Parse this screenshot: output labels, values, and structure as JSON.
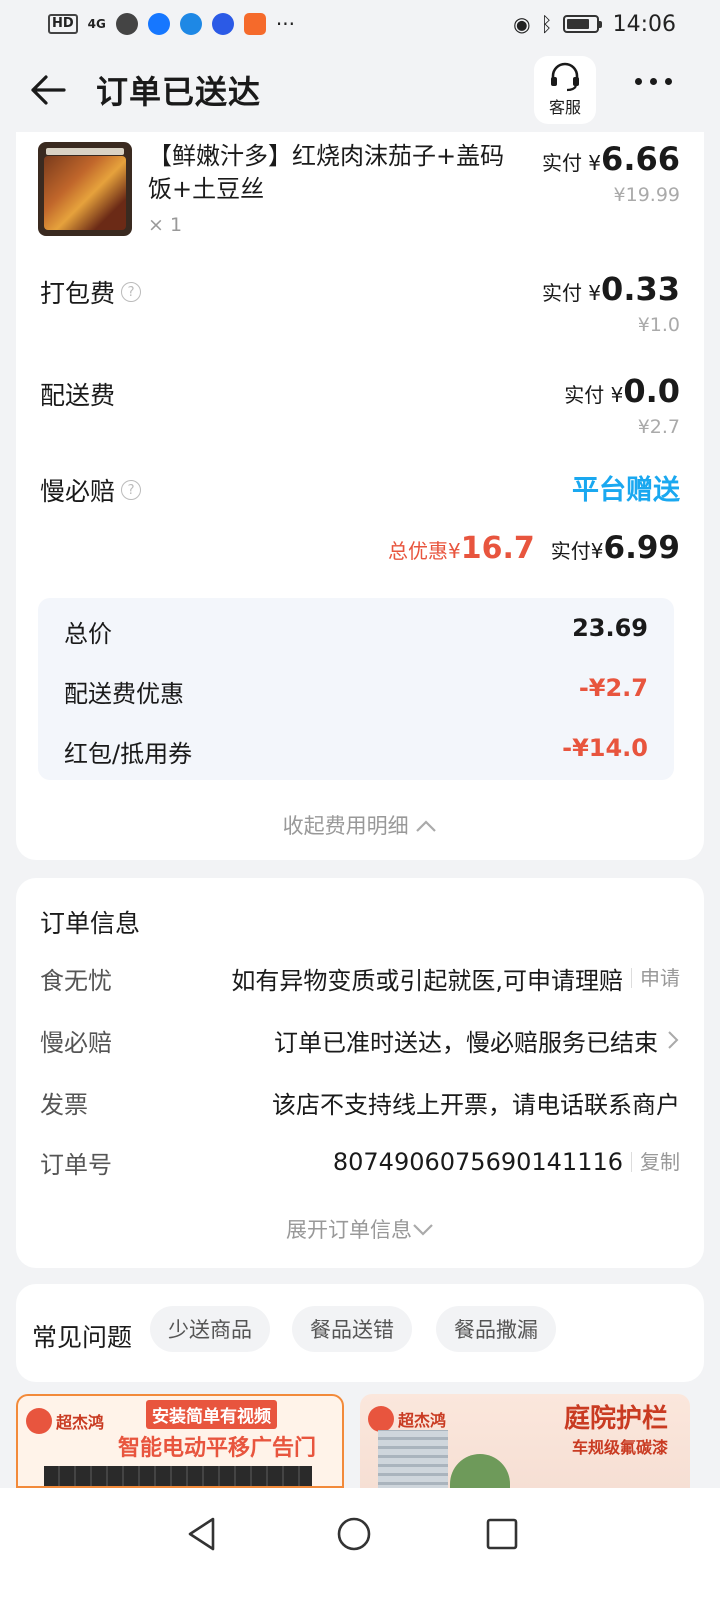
{
  "status_bar": {
    "network": "HD",
    "signal": "4G",
    "time": "14:06"
  },
  "header": {
    "title": "订单已送达",
    "service_label": "客服"
  },
  "item": {
    "name": "【鲜嫩汁多】红烧肉沫茄子+盖码饭+土豆丝",
    "qty": "× 1",
    "paid_prefix": "实付 ¥",
    "paid": "6.66",
    "original": "¥19.99"
  },
  "fees": [
    {
      "label": "打包费",
      "paid_prefix": "实付 ¥",
      "paid": "0.33",
      "original": "¥1.0"
    },
    {
      "label": "配送费",
      "paid_prefix": "实付 ¥",
      "paid": "0.0",
      "original": "¥2.7"
    }
  ],
  "slow_compensation": {
    "label": "慢必赔",
    "value": "平台赠送"
  },
  "summary": {
    "discount_label": "总优惠¥",
    "discount": "16.7",
    "paid_label": "实付¥",
    "paid": "6.99"
  },
  "breakdown": [
    {
      "label": "总价",
      "value": "23.69"
    },
    {
      "label": "配送费优惠",
      "value": "-¥2.7"
    },
    {
      "label": "红包/抵用券",
      "value": "-¥14.0"
    }
  ],
  "collapse_label": "收起费用明细",
  "order_info": {
    "title": "订单信息",
    "rows": [
      {
        "key": "食无忧",
        "value": "如有异物变质或引起就医,可申请理赔",
        "action": "申请"
      },
      {
        "key": "慢必赔",
        "value": "订单已准时送达，慢必赔服务已结束"
      },
      {
        "key": "发票",
        "value": "该店不支持线上开票，请电话联系商户"
      },
      {
        "key": "订单号",
        "value": "8074906075690141116",
        "action": "复制"
      }
    ],
    "expand_label": "展开订单信息"
  },
  "faq": {
    "title": "常见问题",
    "chips": [
      "少送商品",
      "餐品送错",
      "餐品撒漏"
    ]
  },
  "ads": [
    {
      "brand": "超杰鸿",
      "badge": "安装简单有视频",
      "main": "智能电动平移广告门"
    },
    {
      "brand": "超杰鸿",
      "title": "庭院护栏",
      "sub": "车规级氟碳漆"
    }
  ],
  "colors": {
    "accent_red": "#e8553e",
    "accent_blue": "#1aa8f0",
    "background": "#f2f3f5"
  }
}
